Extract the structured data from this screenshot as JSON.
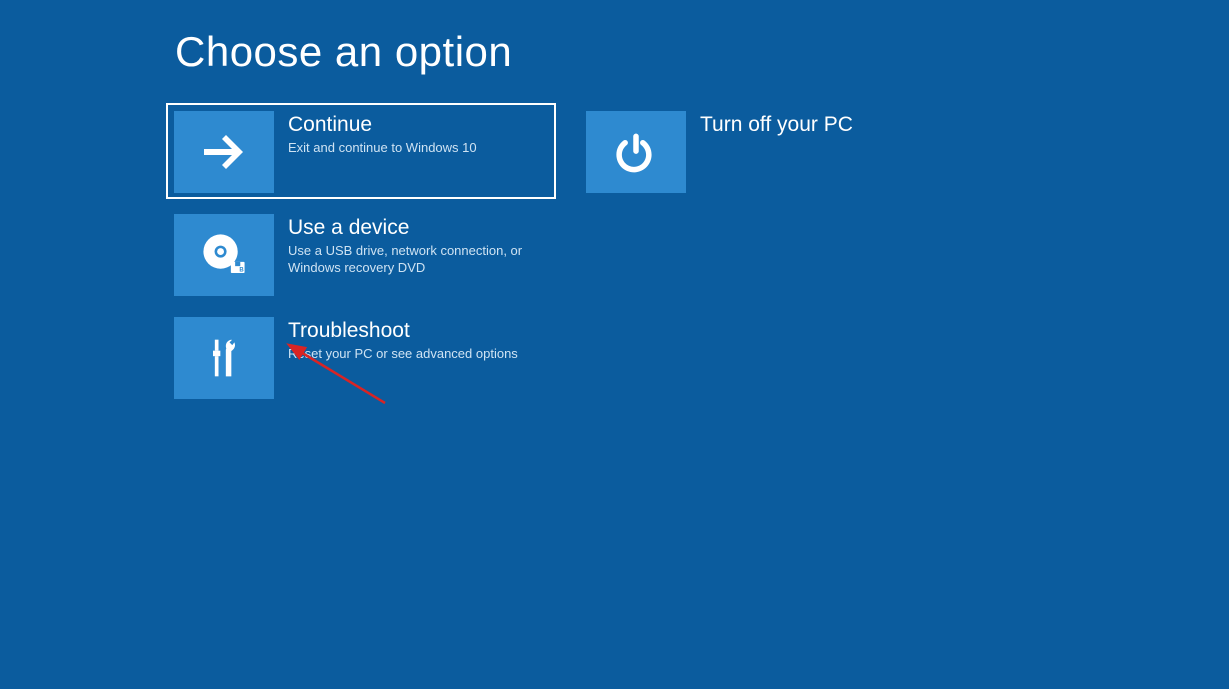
{
  "page": {
    "title": "Choose an option"
  },
  "colors": {
    "background": "#0B5C9E",
    "tile_icon_bg": "#2E8AD0",
    "text": "#FFFFFF",
    "subtitle": "#CFE3F3",
    "annotation": "#D92424"
  },
  "options": {
    "continue": {
      "title": "Continue",
      "subtitle": "Exit and continue to Windows 10",
      "selected": true,
      "icon": "arrow-right"
    },
    "turn_off": {
      "title": "Turn off your PC",
      "subtitle": "",
      "selected": false,
      "icon": "power"
    },
    "use_device": {
      "title": "Use a device",
      "subtitle": "Use a USB drive, network connection, or Windows recovery DVD",
      "selected": false,
      "icon": "disc"
    },
    "troubleshoot": {
      "title": "Troubleshoot",
      "subtitle": "Reset your PC or see advanced options",
      "selected": false,
      "icon": "tools"
    }
  },
  "annotation": {
    "target": "troubleshoot",
    "type": "arrow"
  }
}
